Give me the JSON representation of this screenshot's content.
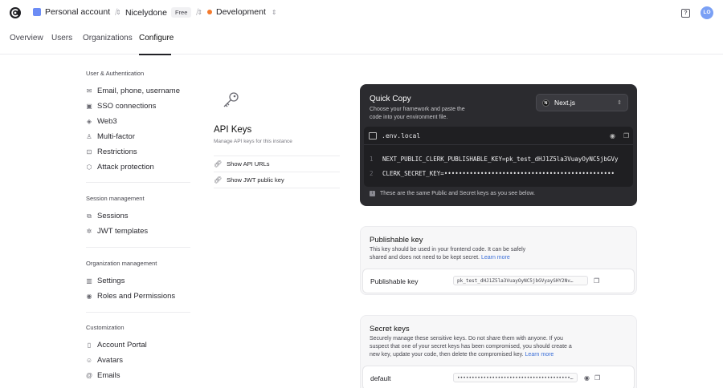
{
  "topbar": {
    "account": "Personal account",
    "app": "Nicelydone",
    "plan_badge": "Free",
    "environment": "Development",
    "user_initials": "LO",
    "help_icon": "?"
  },
  "tabs": [
    "Overview",
    "Users",
    "Organizations",
    "Configure"
  ],
  "sidebar": {
    "sections": [
      {
        "heading": "User & Authentication",
        "items": [
          "Email, phone, username",
          "SSO connections",
          "Web3",
          "Multi-factor",
          "Restrictions",
          "Attack protection"
        ]
      },
      {
        "heading": "Session management",
        "items": [
          "Sessions",
          "JWT templates"
        ]
      },
      {
        "heading": "Organization management",
        "items": [
          "Settings",
          "Roles and Permissions"
        ]
      },
      {
        "heading": "Customization",
        "items": [
          "Account Portal",
          "Avatars",
          "Emails"
        ]
      }
    ]
  },
  "api": {
    "title": "API Keys",
    "subtitle": "Manage API keys for this instance",
    "links": [
      "Show API URLs",
      "Show JWT public key"
    ]
  },
  "quick_copy": {
    "title": "Quick Copy",
    "description": "Choose your framework and paste the code into your environment file.",
    "framework": "Next.js",
    "file_name": ".env.local",
    "lines": [
      {
        "no": "1",
        "text": "NEXT_PUBLIC_CLERK_PUBLISHABLE_KEY=pk_test_dHJ1Z5la3VuayOyNC5jbGVy"
      },
      {
        "no": "2",
        "text": "CLERK_SECRET_KEY=•••••••••••••••••••••••••••••••••••••••••••••••"
      }
    ],
    "note": "These are the same Public and Secret keys as you see below."
  },
  "publishable": {
    "title": "Publishable key",
    "description": "This key should be used in your frontend code. It can be safely shared and does not need to be kept secret.",
    "learn_more": "Learn more",
    "row_label": "Publishable key",
    "row_value": "pk_test_dHJ1Z5la3VuayOyNC5jbGVyaySHY2Nv…"
  },
  "secret": {
    "title": "Secret keys",
    "description": "Securely manage these sensitive keys. Do not share them with anyone. If you suspect that one of your secret keys has been compromised, you should create a new key, update your code, then delete the compromised key.",
    "learn_more": "Learn more",
    "row_label": "default",
    "row_value": "•••••••••••••••••••••••••••••••••••••••…"
  }
}
